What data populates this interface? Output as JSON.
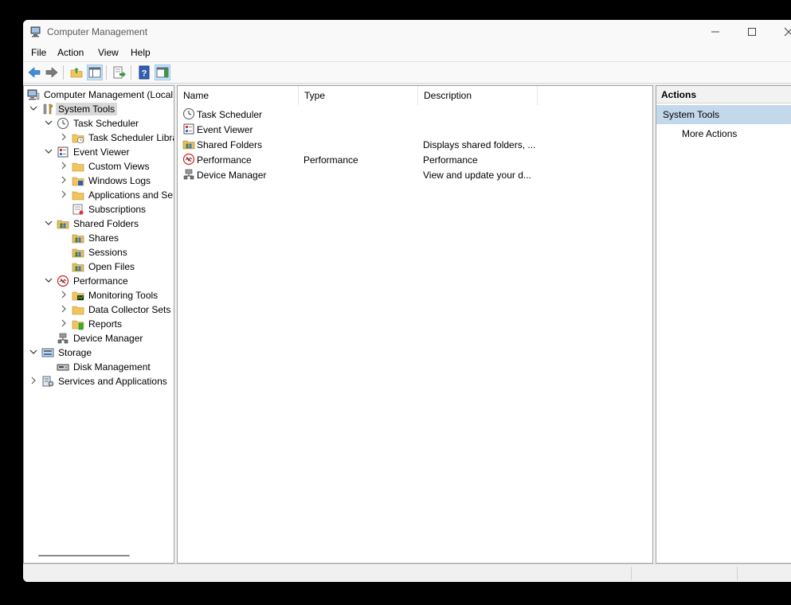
{
  "window": {
    "title": "Computer Management"
  },
  "menu": [
    "File",
    "Action",
    "View",
    "Help"
  ],
  "tree": [
    {
      "label": "Computer Management (Local",
      "level": 0,
      "chevron": "none",
      "icon": "computer-management-icon"
    },
    {
      "label": "System Tools",
      "level": 1,
      "chevron": "down",
      "icon": "system-tools-icon",
      "selected": true
    },
    {
      "label": "Task Scheduler",
      "level": 2,
      "chevron": "down",
      "icon": "clock-icon"
    },
    {
      "label": "Task Scheduler Libra",
      "level": 3,
      "chevron": "right",
      "icon": "folder-clock-icon"
    },
    {
      "label": "Event Viewer",
      "level": 2,
      "chevron": "down",
      "icon": "event-viewer-icon"
    },
    {
      "label": "Custom Views",
      "level": 3,
      "chevron": "right",
      "icon": "folder-icon"
    },
    {
      "label": "Windows Logs",
      "level": 3,
      "chevron": "right",
      "icon": "folder-log-icon"
    },
    {
      "label": "Applications and Se",
      "level": 3,
      "chevron": "right",
      "icon": "folder-icon"
    },
    {
      "label": "Subscriptions",
      "level": 3,
      "chevron": "none",
      "icon": "subscriptions-icon"
    },
    {
      "label": "Shared Folders",
      "level": 2,
      "chevron": "down",
      "icon": "shared-folders-icon"
    },
    {
      "label": "Shares",
      "level": 3,
      "chevron": "none",
      "icon": "shared-folders-icon"
    },
    {
      "label": "Sessions",
      "level": 3,
      "chevron": "none",
      "icon": "shared-folders-icon"
    },
    {
      "label": "Open Files",
      "level": 3,
      "chevron": "none",
      "icon": "shared-folders-icon"
    },
    {
      "label": "Performance",
      "level": 2,
      "chevron": "down",
      "icon": "performance-icon"
    },
    {
      "label": "Monitoring Tools",
      "level": 3,
      "chevron": "right",
      "icon": "folder-monitor-icon"
    },
    {
      "label": "Data Collector Sets",
      "level": 3,
      "chevron": "right",
      "icon": "folder-icon"
    },
    {
      "label": "Reports",
      "level": 3,
      "chevron": "right",
      "icon": "folder-report-icon"
    },
    {
      "label": "Device Manager",
      "level": 2,
      "chevron": "none",
      "icon": "device-manager-icon"
    },
    {
      "label": "Storage",
      "level": 1,
      "chevron": "down",
      "icon": "storage-icon"
    },
    {
      "label": "Disk Management",
      "level": 2,
      "chevron": "none",
      "icon": "disk-icon"
    },
    {
      "label": "Services and Applications",
      "level": 1,
      "chevron": "right",
      "icon": "services-icon"
    }
  ],
  "list": {
    "columns": [
      "Name",
      "Type",
      "Description"
    ],
    "rows": [
      {
        "name": "Task Scheduler",
        "type": "",
        "description": "",
        "icon": "clock-icon"
      },
      {
        "name": "Event Viewer",
        "type": "",
        "description": "",
        "icon": "event-viewer-icon"
      },
      {
        "name": "Shared Folders",
        "type": "",
        "description": "Displays shared folders, ...",
        "icon": "shared-folders-icon"
      },
      {
        "name": "Performance",
        "type": "Performance",
        "description": "Performance",
        "icon": "performance-icon"
      },
      {
        "name": "Device Manager",
        "type": "",
        "description": "View and update your d...",
        "icon": "device-manager-icon"
      }
    ]
  },
  "actions": {
    "header": "Actions",
    "section": "System Tools",
    "items": [
      "More Actions"
    ]
  },
  "colors": {
    "selection": "#d9d9d9",
    "actions_section": "#c4d8ec",
    "pane_border": "#a0a0a0"
  }
}
